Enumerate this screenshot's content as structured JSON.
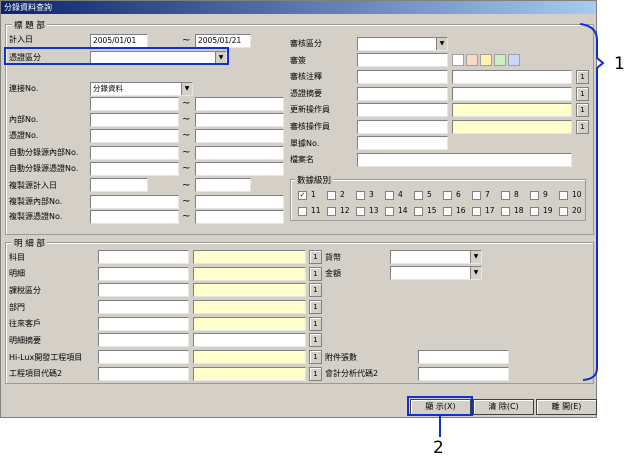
{
  "window": {
    "title": "分錄資料查詢"
  },
  "header": {
    "title": "標 題 部",
    "entry_date_label": "計入日",
    "entry_date_from": "2005/01/01",
    "entry_date_to": "2005/01/21",
    "voucher_type_label": "憑證區分",
    "connection_label": "連接No.",
    "connection_value": "分錄資料",
    "internal_no_label": "內部No.",
    "voucher_no_label": "憑證No.",
    "auto_source_internal_label": "自動分錄源內部No.",
    "auto_source_voucher_label": "自動分錄源憑證No.",
    "copy_source_date_label": "複製源計入日",
    "copy_source_internal_label": "複製源內部No.",
    "copy_source_voucher_label": "複製源憑證No.",
    "review_type_label": "審核區分",
    "reviewer_label": "審簽",
    "review_note_label": "審核注釋",
    "voucher_summary_label": "憑證摘要",
    "updater_label": "更新操作員",
    "review_operator_label": "審核操作員",
    "slip_no_label": "單據No.",
    "file_name_label": "檔案名",
    "level_label": "數據級別",
    "levels": [
      "1",
      "2",
      "3",
      "4",
      "5",
      "6",
      "7",
      "8",
      "9",
      "10",
      "11",
      "12",
      "13",
      "14",
      "15",
      "16",
      "17",
      "18",
      "19",
      "20"
    ]
  },
  "detail": {
    "title": "明 細 部",
    "account_label": "科目",
    "sub_label": "明細",
    "tax_label": "課稅區分",
    "dept_label": "部門",
    "customer_label": "往來客戶",
    "detail_summary_label": "明細摘要",
    "project_label": "Hi-Lux開發工程項目",
    "project_code2_label": "工程項目代碼2",
    "currency_label": "貨幣",
    "amount_label": "金額",
    "attachments_label": "附件張數",
    "analysis_code2_label": "會計分析代碼2"
  },
  "buttons": {
    "lookup": "1",
    "display": "顯 示(X)",
    "clear": "清 除(C)",
    "close": "離 開(E)"
  },
  "callouts": {
    "one": "1",
    "two": "2"
  },
  "colors": {
    "highlight": "#1030d0",
    "yellow_field": "#ffffcc",
    "titlebar": "#0a246a"
  }
}
